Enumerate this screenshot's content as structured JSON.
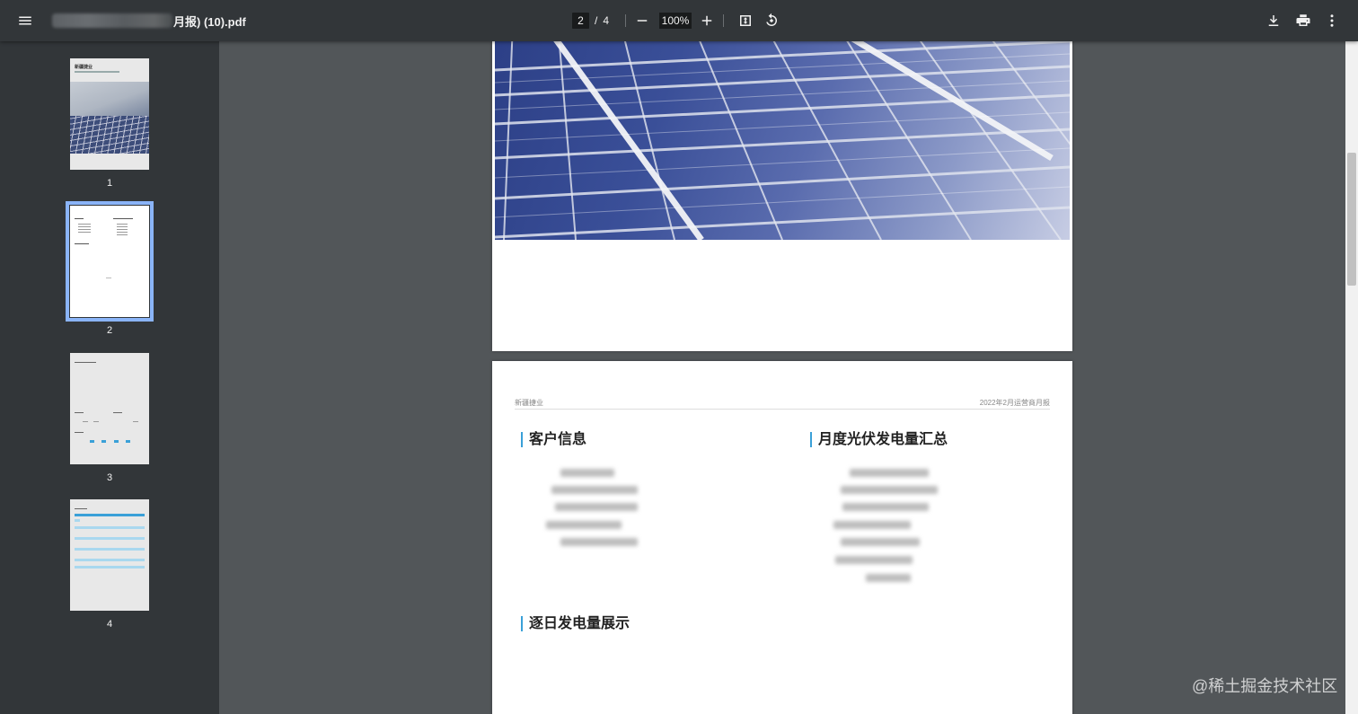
{
  "toolbar": {
    "title_visible": "月报) (10).pdf",
    "current_page": "2",
    "page_separator": "/",
    "total_pages": "4",
    "zoom": "100%",
    "icons": [
      "menu-icon",
      "zoom-out-icon",
      "zoom-in-icon",
      "fit-page-icon",
      "rotate-icon",
      "download-icon",
      "print-icon",
      "more-vert-icon"
    ]
  },
  "sidebar": {
    "thumbnails": [
      {
        "number": "1",
        "selected": false,
        "title": "新疆捷业"
      },
      {
        "number": "2",
        "selected": true
      },
      {
        "number": "3",
        "selected": false
      },
      {
        "number": "4",
        "selected": false
      }
    ]
  },
  "page2": {
    "header_left": "新疆捷业",
    "header_right": "2022年2月运营商月报",
    "section_customer": "客户信息",
    "section_monthly": "月度光伏发电量汇总",
    "section_daily": "逐日发电量展示"
  },
  "watermark": "@稀土掘金技术社区",
  "colors": {
    "toolbar_bg": "#323639",
    "viewer_bg": "#525659",
    "accent_selected": "#8ab4f8",
    "section_accent": "#3aa0d8"
  }
}
